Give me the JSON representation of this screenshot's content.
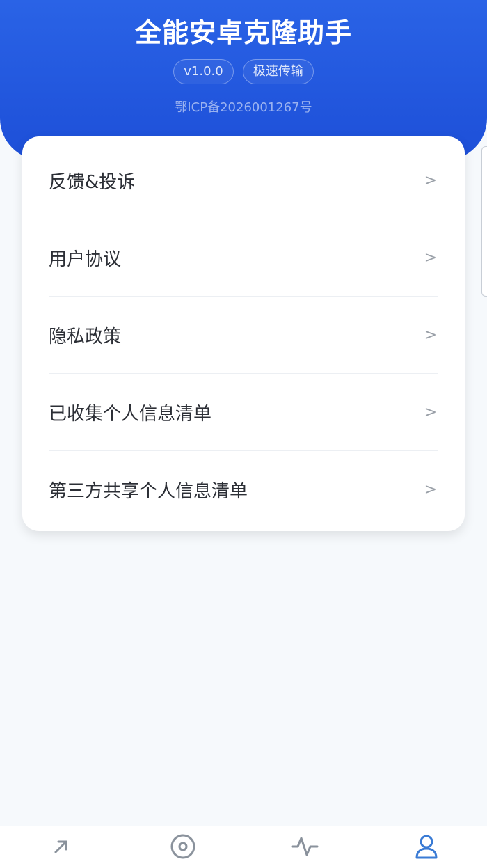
{
  "header": {
    "title": "全能安卓克隆助手",
    "badges": [
      "v1.0.0",
      "极速传输"
    ],
    "icp": "鄂ICP备2026001267号"
  },
  "menu": {
    "items": [
      {
        "label": "反馈&投诉",
        "chevron": ">"
      },
      {
        "label": "用户协议",
        "chevron": ">"
      },
      {
        "label": "隐私政策",
        "chevron": ">"
      },
      {
        "label": "已收集个人信息清单",
        "chevron": ">"
      },
      {
        "label": "第三方共享个人信息清单",
        "chevron": ">"
      }
    ]
  },
  "tabbar": {
    "tabs": [
      {
        "icon": "arrow-up-right-icon",
        "active": false
      },
      {
        "icon": "target-icon",
        "active": false
      },
      {
        "icon": "activity-icon",
        "active": false
      },
      {
        "icon": "user-icon",
        "active": true
      }
    ],
    "active_color": "#3a7bd5",
    "inactive_color": "#8a929c"
  },
  "colors": {
    "header_blue": "#2a63e6",
    "page_background": "#f6f9fc"
  }
}
